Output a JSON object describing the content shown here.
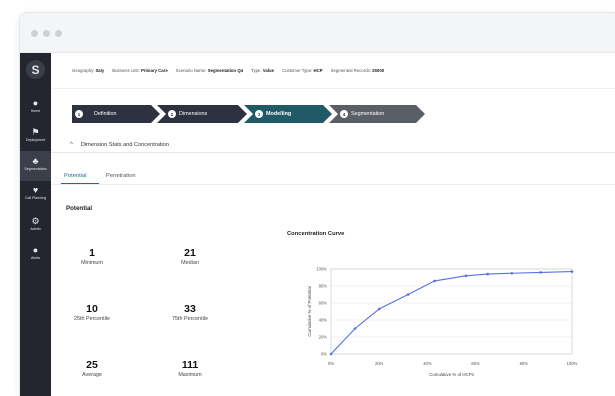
{
  "sidebar": {
    "logo": "S",
    "items": [
      {
        "label": "Home",
        "icon": "●"
      },
      {
        "label": "Deployment",
        "icon": "⚑"
      },
      {
        "label": "Segmentation",
        "icon": "♣"
      },
      {
        "label": "Call Planning",
        "icon": "♥"
      },
      {
        "label": "Admin",
        "icon": "⚙"
      },
      {
        "label": "Alerts",
        "icon": "●"
      }
    ]
  },
  "info": {
    "geography_label": "Geography:",
    "geography_value": "Italy",
    "business_unit_label": "Business Unit:",
    "business_unit_value": "Primary Care",
    "scenario_label": "Scenario Name:",
    "scenario_value": "Segmentation Q4",
    "type_label": "Type:",
    "type_value": "Value",
    "customer_type_label": "Customer Type:",
    "customer_type_value": "HCP",
    "segmented_label": "Segmented Records:",
    "segmented_value": "25000"
  },
  "steps": [
    {
      "num": "1",
      "label": "Definition"
    },
    {
      "num": "2",
      "label": "Dimensions"
    },
    {
      "num": "3",
      "label": "Modelling"
    },
    {
      "num": "4",
      "label": "Segmentation"
    }
  ],
  "panel": {
    "chevron": "^",
    "title": "Dimension Stats and Concentration"
  },
  "tabs": {
    "potential": "Potential",
    "penetration": "Penetration"
  },
  "section_title": "Potential",
  "stats": {
    "minimum": {
      "value": "1",
      "label": "Minimum"
    },
    "median": {
      "value": "21",
      "label": "Median"
    },
    "p25": {
      "value": "10",
      "label": "25th Percentile"
    },
    "p75": {
      "value": "33",
      "label": "75th Percentile"
    },
    "average": {
      "value": "25",
      "label": "Average"
    },
    "maximum": {
      "value": "111",
      "label": "Maximum"
    }
  },
  "chart_data": {
    "type": "line",
    "title": "Concentration Curve",
    "xlabel": "Cumulative % of HCPs",
    "ylabel": "Cumulative % of Potential",
    "x_ticks": [
      "0%",
      "20%",
      "40%",
      "60%",
      "80%",
      "100%"
    ],
    "y_ticks": [
      "0%",
      "20%",
      "40%",
      "60%",
      "80%",
      "100%"
    ],
    "xlim": [
      0,
      100
    ],
    "ylim": [
      0,
      100
    ],
    "grid": true,
    "color": "#5b6ee0",
    "x": [
      0,
      10,
      20,
      32,
      43,
      56,
      65,
      75,
      87,
      100
    ],
    "y": [
      0,
      30,
      53,
      70,
      86,
      92,
      94,
      95,
      96,
      97
    ]
  }
}
